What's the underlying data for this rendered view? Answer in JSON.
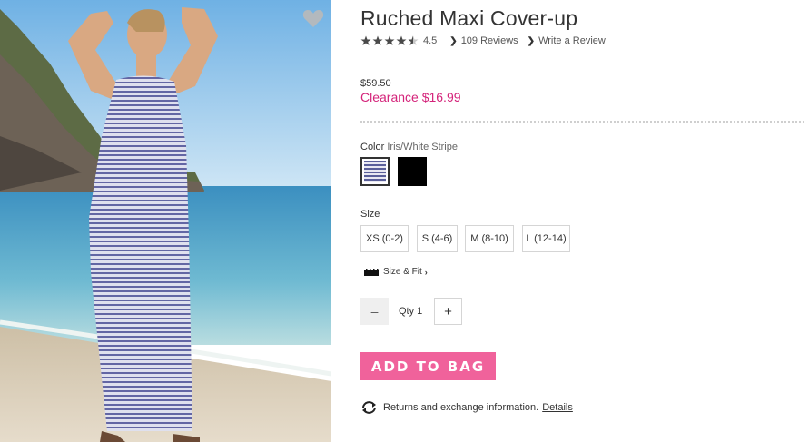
{
  "product": {
    "title": "Ruched Maxi Cover-up",
    "rating": "4.5",
    "rating_value": 4.5,
    "rating_max": 5,
    "reviews_link": "109 Reviews",
    "write_review_link": "Write a Review",
    "original_price": "$59.50",
    "sale_price": "Clearance $16.99",
    "color_label": "Color",
    "color_value": "Iris/White Stripe",
    "size_label": "Size",
    "sizes": [
      "XS (0-2)",
      "S (4-6)",
      "M (8-10)",
      "L (12-14)"
    ],
    "size_fit_link": "Size & Fit",
    "qty_label": "Qty 1",
    "qty_minus": "–",
    "qty_plus": "+",
    "add_to_bag": "ADD TO BAG",
    "returns_text": "Returns and exchange information.",
    "details_link": "Details"
  },
  "icons": {
    "favorite": "heart-icon",
    "star": "star-icon",
    "chevron": "chevron-right-icon",
    "ruler": "ruler-icon",
    "returns": "returns-arrows-icon"
  },
  "colors": {
    "sale": "#d4237a",
    "button": "#f0629b",
    "swatch_iris": "#5a5f9a",
    "swatch_black": "#000000"
  }
}
